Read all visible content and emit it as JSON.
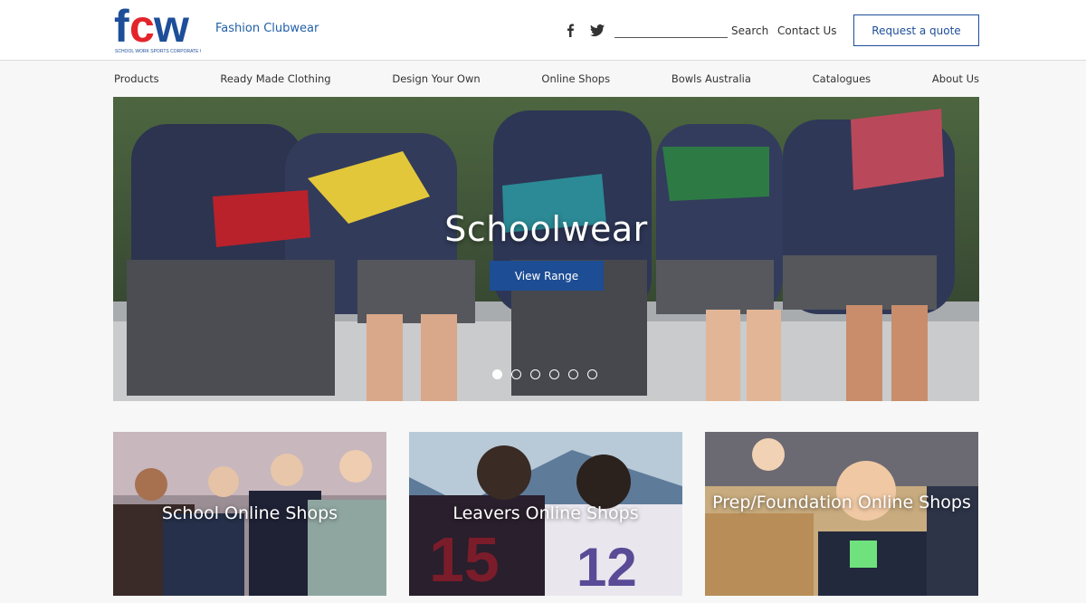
{
  "brand": {
    "name": "Fashion Clubwear",
    "logo_text": "fcw",
    "logo_tagline": "SCHOOL WORK SPORTS CORPORATE WEAR"
  },
  "header": {
    "social": [
      "facebook-icon",
      "twitter-icon"
    ],
    "search": {
      "label": "Search",
      "value": "",
      "placeholder": ""
    },
    "contact_label": "Contact Us",
    "quote_label": "Request a quote"
  },
  "nav": {
    "items": [
      "Products",
      "Ready Made Clothing",
      "Design Your Own",
      "Online Shops",
      "Bowls Australia",
      "Catalogues",
      "About Us"
    ]
  },
  "hero": {
    "title": "Schoolwear",
    "button_label": "View Range",
    "slides": 6,
    "active_slide": 1
  },
  "cards": [
    {
      "title": "School Online Shops"
    },
    {
      "title": "Leavers Online Shops"
    },
    {
      "title": "Prep/Foundation Online Shops"
    }
  ],
  "colors": {
    "brand_blue": "#1e4e99",
    "logo_red": "#e3242b",
    "logo_blue": "#1e4e99"
  }
}
